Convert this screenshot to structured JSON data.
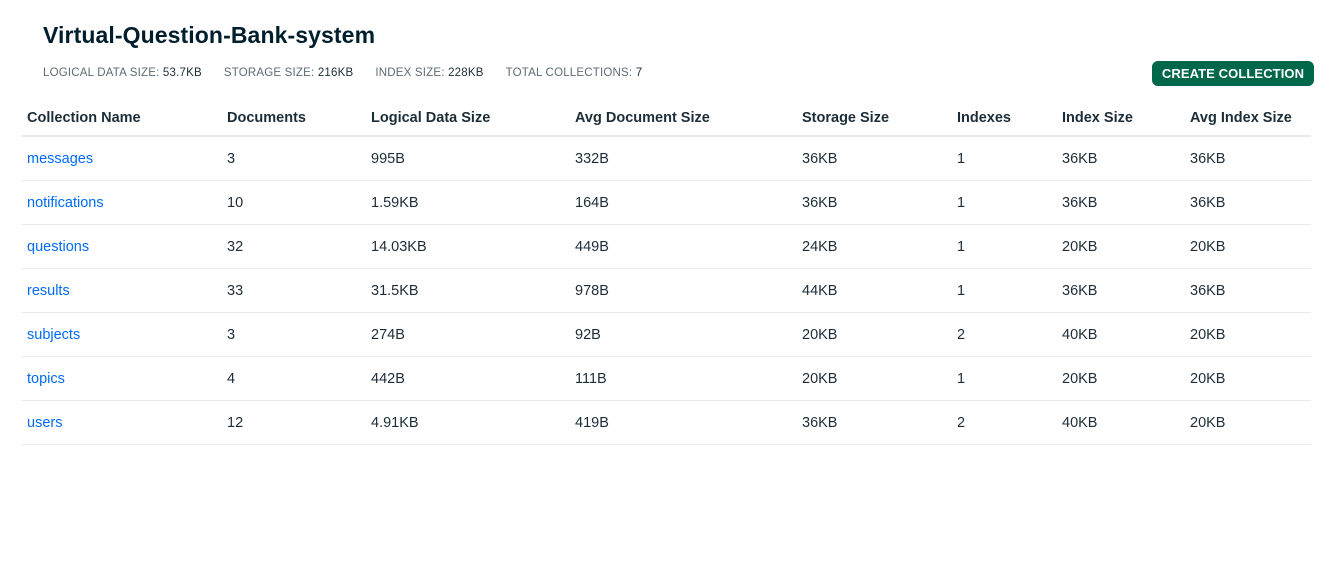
{
  "database": {
    "title": "Virtual-Question-Bank-system",
    "stats": [
      {
        "label": "LOGICAL DATA SIZE:",
        "value": "53.7KB"
      },
      {
        "label": "STORAGE SIZE:",
        "value": "216KB"
      },
      {
        "label": "INDEX SIZE:",
        "value": "228KB"
      },
      {
        "label": "TOTAL COLLECTIONS:",
        "value": "7"
      }
    ],
    "create_button_label": "CREATE COLLECTION"
  },
  "table": {
    "headers": [
      "Collection Name",
      "Documents",
      "Logical Data Size",
      "Avg Document Size",
      "Storage Size",
      "Indexes",
      "Index Size",
      "Avg Index Size"
    ],
    "rows": [
      [
        "messages",
        "3",
        "995B",
        "332B",
        "36KB",
        "1",
        "36KB",
        "36KB"
      ],
      [
        "notifications",
        "10",
        "1.59KB",
        "164B",
        "36KB",
        "1",
        "36KB",
        "36KB"
      ],
      [
        "questions",
        "32",
        "14.03KB",
        "449B",
        "24KB",
        "1",
        "20KB",
        "20KB"
      ],
      [
        "results",
        "33",
        "31.5KB",
        "978B",
        "44KB",
        "1",
        "36KB",
        "36KB"
      ],
      [
        "subjects",
        "3",
        "274B",
        "92B",
        "20KB",
        "2",
        "40KB",
        "20KB"
      ],
      [
        "topics",
        "4",
        "442B",
        "111B",
        "20KB",
        "1",
        "20KB",
        "20KB"
      ],
      [
        "users",
        "12",
        "4.91KB",
        "419B",
        "36KB",
        "2",
        "40KB",
        "20KB"
      ]
    ]
  },
  "colors": {
    "accent_button": "#00684a",
    "link": "#016bf8",
    "title": "#001e2b"
  }
}
